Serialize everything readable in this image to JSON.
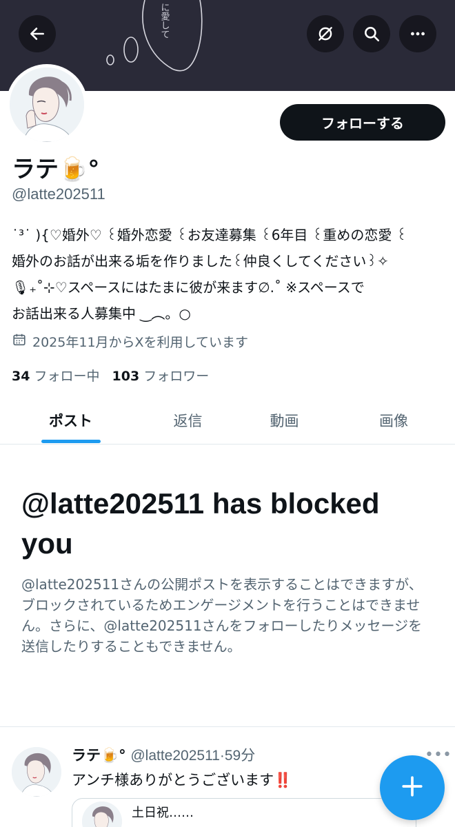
{
  "header": {
    "banner_text": "に愛して",
    "back_icon": "arrow-left-icon",
    "grok_icon": "grok-icon",
    "search_icon": "search-icon",
    "more_icon": "more-horizontal-icon"
  },
  "profile": {
    "display_name": "ラテ🍺°",
    "handle": "@latte202511",
    "follow_label": "フォローする",
    "bio_lines": [
      "˙³˙ ){♡婚外♡ ꒰婚外恋愛 ꒰お友達募集 ꒰6年目 ꒰重めの恋愛 ꒰",
      "婚外のお話が出来る垢を作りました꒰仲良くしてください꒱✧",
      "🎙₊˚⊹♡スペースにはたまに彼が来ます∅.˚ ※スペースで",
      "お話出来る人募集中 ‿︵。○"
    ],
    "joined_text": "2025年11月からXを利用しています",
    "following_count": "34",
    "following_label": "フォロー中",
    "followers_count": "103",
    "followers_label": "フォロワー"
  },
  "tabs": [
    {
      "label": "ポスト",
      "active": true
    },
    {
      "label": "返信",
      "active": false
    },
    {
      "label": "動画",
      "active": false
    },
    {
      "label": "画像",
      "active": false
    }
  ],
  "blocked": {
    "title": "@latte202511 has blocked you",
    "description": "@latte202511さんの公開ポストを表示することはできますが、ブロックされているためエンゲージメントを行うことはできません。さらに、@latte202511さんをフォローしたりメッセージを送信したりすることもできません。"
  },
  "post": {
    "name": "ラテ🍺°",
    "handle": "@latte202511",
    "separator": "·",
    "time": "59分",
    "text": "アンチ様ありがとうございます",
    "emphasis": "‼️",
    "more": "•••",
    "quote_text": "土日祝……"
  },
  "fab": {
    "label": "+",
    "icon": "plus-icon"
  },
  "colors": {
    "accent": "#1d9bf0",
    "text_primary": "#0f1419",
    "text_secondary": "#536471",
    "banner": "#2a2a38"
  }
}
